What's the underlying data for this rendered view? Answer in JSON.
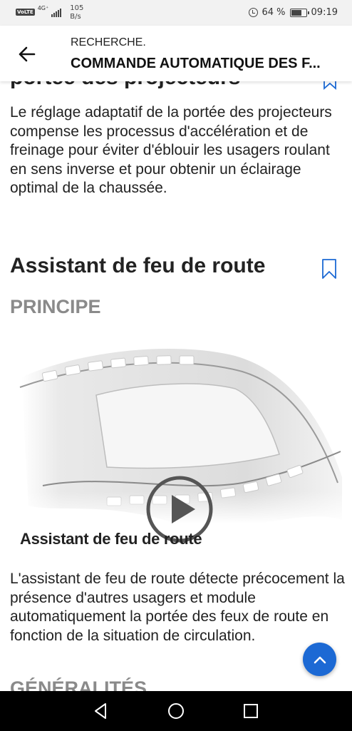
{
  "status_bar": {
    "volte": "VoLTE",
    "network": "4G⁺",
    "speed_value": "105",
    "speed_unit": "B/s",
    "battery": "64 %",
    "time": "09:19"
  },
  "app_bar": {
    "breadcrumb": "RECHERCHE.",
    "title": "COMMANDE AUTOMATIQUE DES F..."
  },
  "content": {
    "cut_heading": "portée des projecteurs",
    "paragraph_1": "Le réglage adaptatif de la portée des projecteurs compense les processus d'accélération et de freinage pour éviter d'éblouir les usagers roulant en sens inverse et pour obtenir un éclairage optimal de la chaussée.",
    "section_title": "Assistant de feu de route",
    "principle_label": "PRINCIPE",
    "video_caption": "Assistant de feu de route",
    "paragraph_2": "L'assistant de feu de route détecte précocement la présence d'autres usagers et module automatiquement la portée des feux de route en fonction de la situation de circulation.",
    "next_label": "GÉNÉRALITÉS"
  },
  "colors": {
    "accent": "#1c69d4",
    "subheading_gray": "#8a8a8a"
  },
  "icons": {
    "back": "arrow-left-icon",
    "bookmark": "bookmark-icon",
    "play": "play-icon",
    "scroll_top": "chevron-up-icon",
    "nav_back": "triangle-back-icon",
    "nav_home": "circle-home-icon",
    "nav_recents": "square-recents-icon"
  }
}
